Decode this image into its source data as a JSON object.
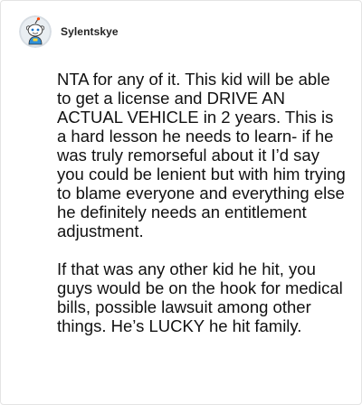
{
  "post": {
    "author": {
      "username": "Sylentskye",
      "avatar_icon": "snoo-avatar-icon"
    },
    "comment": {
      "paragraphs": [
        "NTA for any of it. This kid will be able to get a license and DRIVE AN ACTUAL VEHICLE in 2 years. This is a hard lesson he needs to learn- if he was truly remorseful about it I’d say you could be lenient but with him trying to blame everyone and everything else he definitely needs an entitlement adjustment.",
        "If that was any other kid he hit, you guys would be on the hook for medical bills, possible lawsuit among other things. He’s LUCKY he hit family."
      ]
    }
  },
  "colors": {
    "border": "#e4e4e4",
    "text": "#111111",
    "username": "#222222",
    "avatar_bg": "#d7dde3"
  }
}
